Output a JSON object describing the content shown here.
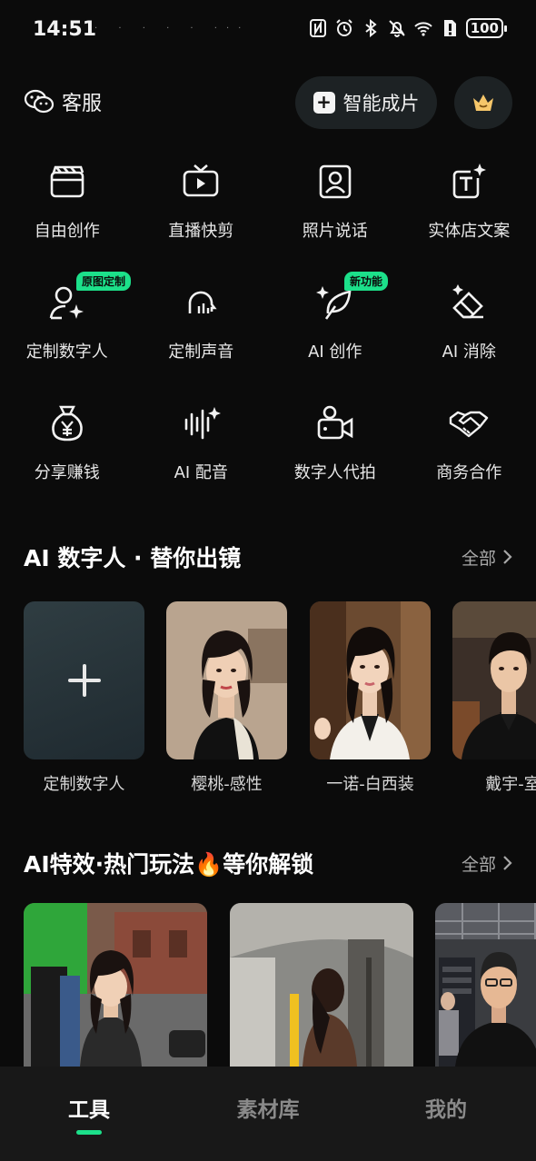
{
  "status_bar": {
    "time": "14:51",
    "dots": "· · · · · ···",
    "battery": "100"
  },
  "top_bar": {
    "service_label": "客服",
    "smart_button_label": "智能成片"
  },
  "tools": [
    {
      "label": "自由创作",
      "icon": "clapperboard-icon"
    },
    {
      "label": "直播快剪",
      "icon": "tv-play-icon"
    },
    {
      "label": "照片说话",
      "icon": "portrait-icon"
    },
    {
      "label": "实体店文案",
      "icon": "text-sparkle-icon"
    },
    {
      "label": "定制数字人",
      "icon": "person-sparkle-icon",
      "badge": "原图定制"
    },
    {
      "label": "定制声音",
      "icon": "voice-head-icon"
    },
    {
      "label": "AI 创作",
      "icon": "feather-sparkle-icon",
      "badge": "新功能"
    },
    {
      "label": "AI 消除",
      "icon": "eraser-sparkle-icon"
    },
    {
      "label": "分享赚钱",
      "icon": "money-bag-icon"
    },
    {
      "label": "AI 配音",
      "icon": "soundwave-icon"
    },
    {
      "label": "数字人代拍",
      "icon": "camera-person-icon"
    },
    {
      "label": "商务合作",
      "icon": "handshake-icon"
    }
  ],
  "avatar_section": {
    "title": "AI 数字人 · 替你出镜",
    "more_label": "全部",
    "items": [
      {
        "label": "定制数字人"
      },
      {
        "label": "樱桃-感性"
      },
      {
        "label": "一诺-白西装"
      },
      {
        "label": "戴宇-室"
      }
    ]
  },
  "effects_section": {
    "title": "AI特效·热门玩法🔥等你解锁",
    "more_label": "全部"
  },
  "bottom_nav": {
    "items": [
      {
        "label": "工具"
      },
      {
        "label": "素材库"
      },
      {
        "label": "我的"
      }
    ]
  },
  "colors": {
    "accent": "#1ce08a",
    "background": "#0b0b0b",
    "nav_background": "#181818"
  }
}
